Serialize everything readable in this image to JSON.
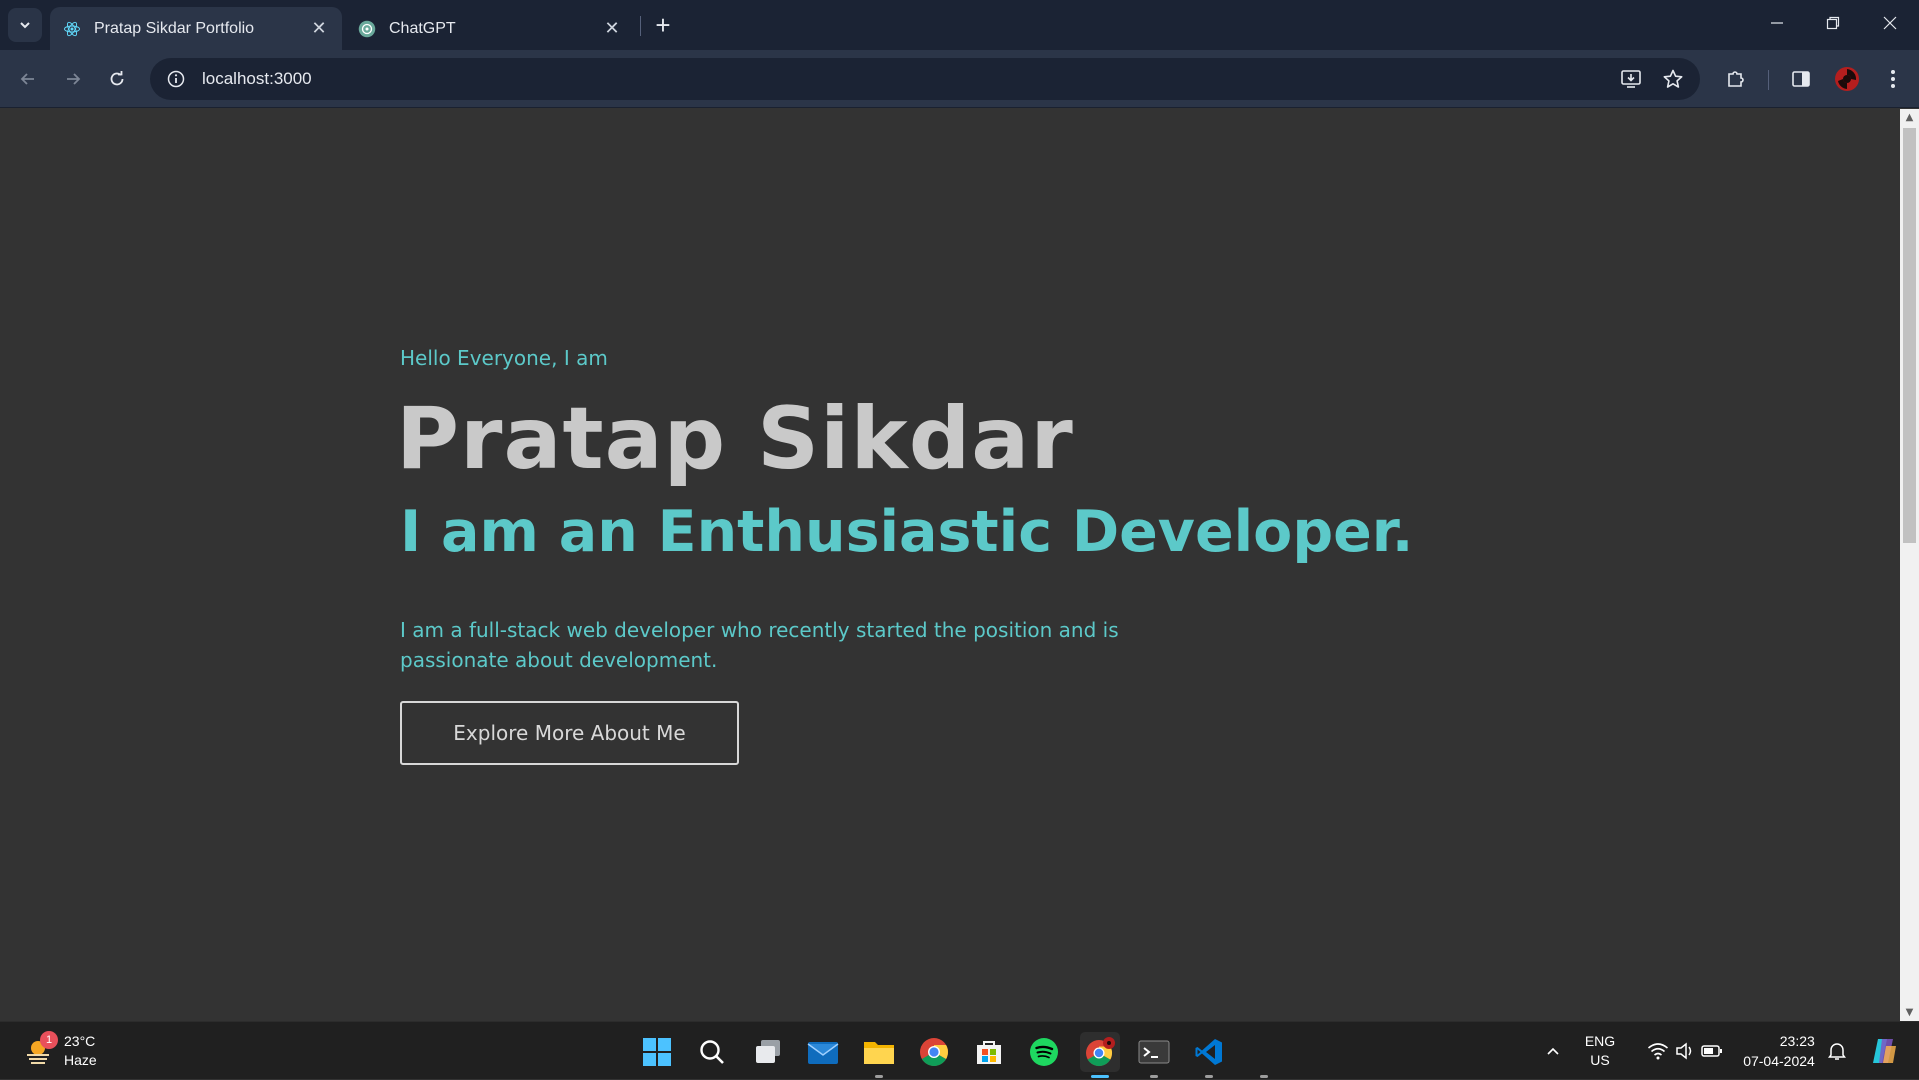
{
  "browser": {
    "tabs": [
      {
        "title": "Pratap Sikdar Portfolio",
        "icon": "react-icon",
        "active": true
      },
      {
        "title": "ChatGPT",
        "icon": "chatgpt-icon",
        "active": false
      }
    ],
    "url": "localhost:3000"
  },
  "hero": {
    "greeting": "Hello Everyone, I am",
    "name": "Pratap Sikdar",
    "tagline": "I am an Enthusiastic Developer.",
    "description": "I am a full-stack web developer who recently started the position and is passionate about development.",
    "cta_label": "Explore More About Me"
  },
  "taskbar": {
    "weather": {
      "temp": "23°C",
      "condition": "Haze",
      "badge": "1"
    },
    "lang_line1": "ENG",
    "lang_line2": "US",
    "time": "23:23",
    "date": "07-04-2024",
    "apps": [
      "start-icon",
      "search-icon",
      "task-view-icon",
      "mail-icon",
      "file-explorer-icon",
      "chrome-icon",
      "store-icon",
      "spotify-icon",
      "chrome-profile-icon",
      "terminal-icon",
      "vscode-icon"
    ]
  },
  "colors": {
    "page_bg": "#333333",
    "accent_teal": "#5cc9c9",
    "name_gray": "#c9c9c9",
    "browser_chrome": "#1b2334",
    "taskbar_bg": "#202020"
  }
}
